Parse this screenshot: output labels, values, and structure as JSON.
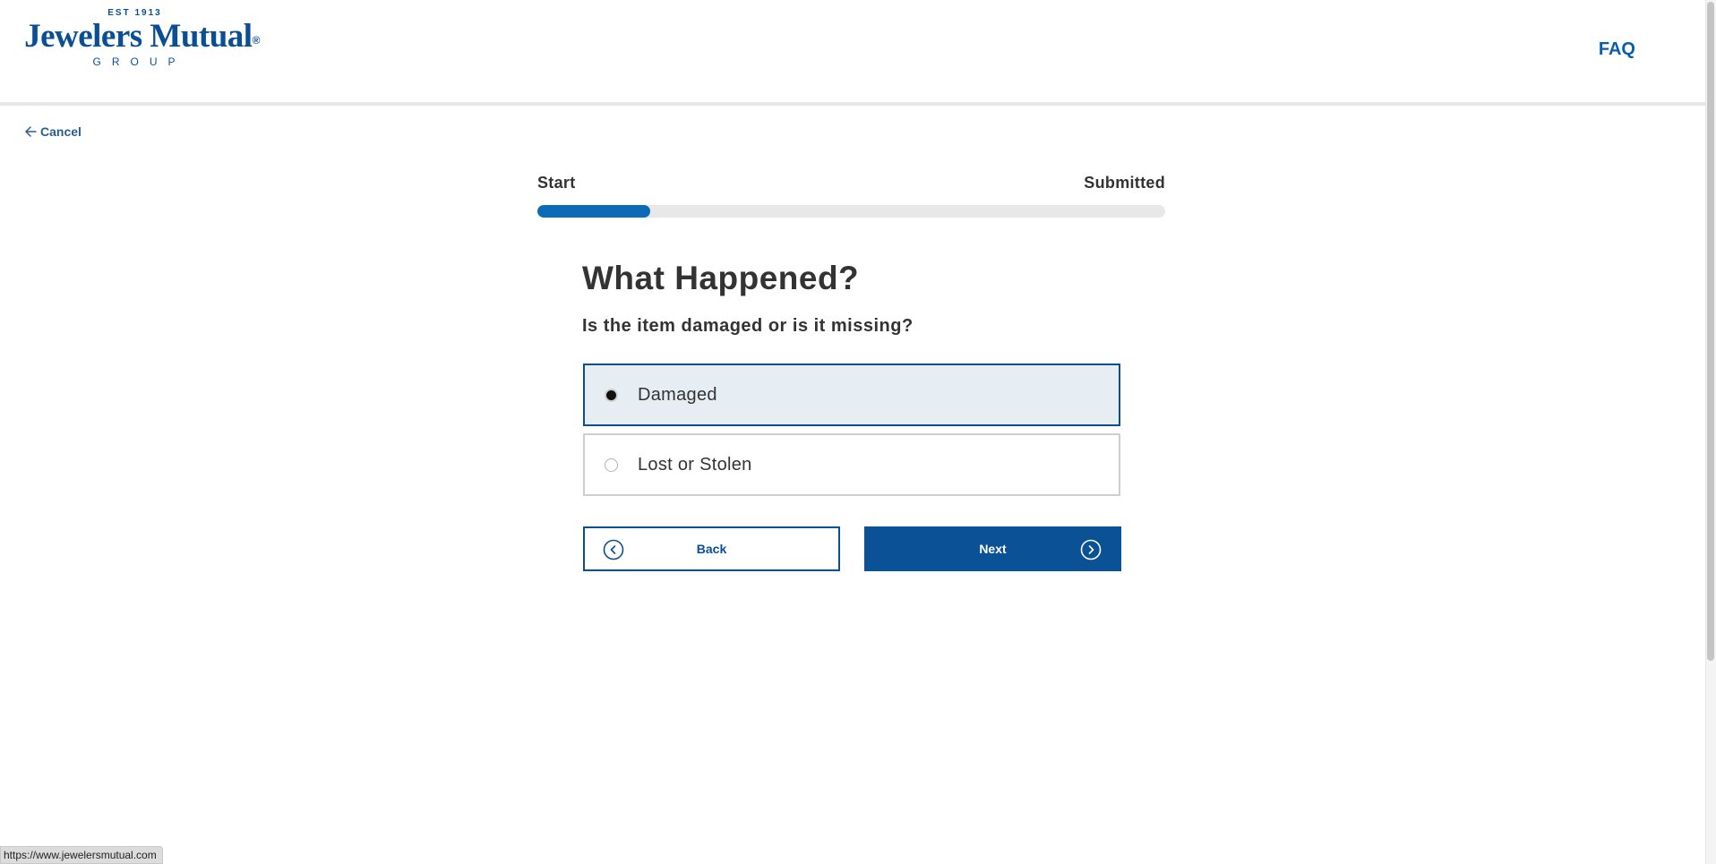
{
  "header": {
    "logo": {
      "est": "EST 1913",
      "name": "Jewelers Mutual",
      "registered": "®",
      "group": "GROUP"
    },
    "faq_label": "FAQ"
  },
  "cancel_label": "Cancel",
  "progress": {
    "start_label": "Start",
    "end_label": "Submitted",
    "fraction": 0.18
  },
  "question": {
    "title": "What Happened?",
    "subtitle": "Is the item damaged or is it missing?",
    "options": [
      {
        "label": "Damaged",
        "selected": true
      },
      {
        "label": "Lost or Stolen",
        "selected": false
      }
    ]
  },
  "buttons": {
    "back_label": "Back",
    "next_label": "Next"
  },
  "status_url": "https://www.jewelersmutual.com",
  "colors": {
    "brand": "#0a4f93",
    "progress_fill": "#0a6bb8",
    "selected_bg": "#e6edf3"
  },
  "icons": {
    "cancel": "arrow-left-icon",
    "back": "chevron-left-circle-icon",
    "next": "chevron-right-circle-icon"
  }
}
